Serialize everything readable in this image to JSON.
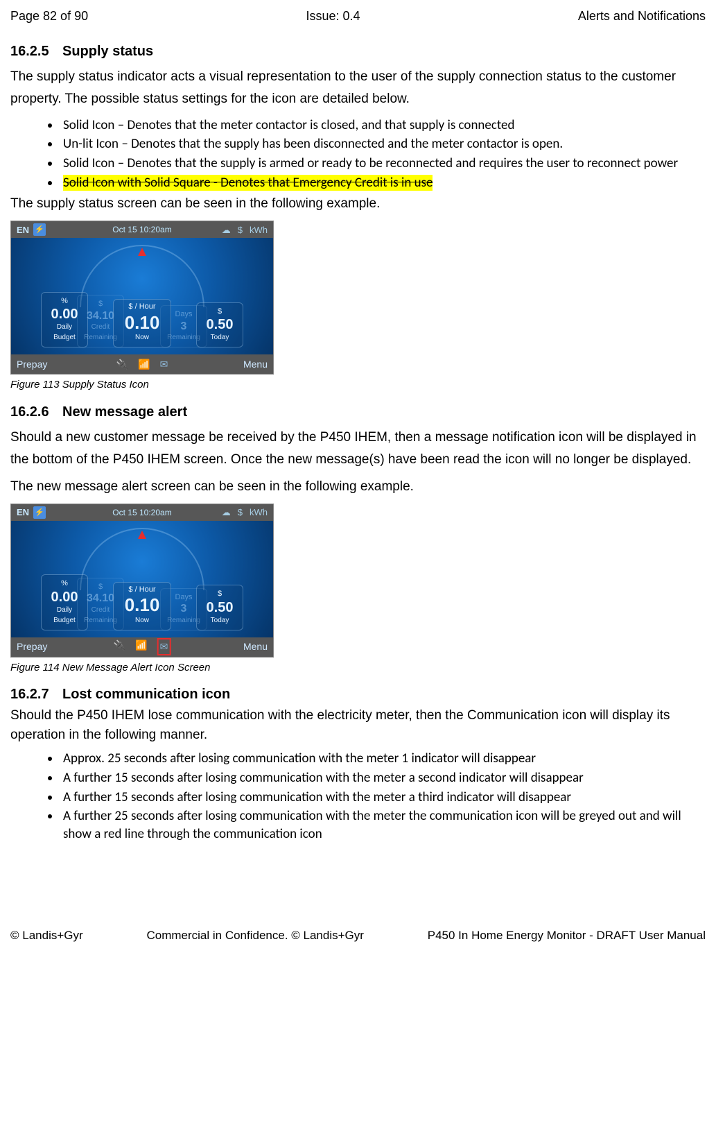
{
  "header": {
    "left": "Page 82 of 90",
    "center": "Issue: 0.4",
    "right": "Alerts and Notifications"
  },
  "s1": {
    "num": "16.2.5",
    "title": "Supply status",
    "p1": "The supply status indicator acts a visual representation to the user of the supply connection status to the customer property. The possible status settings for the icon are detailed below.",
    "b1": "Solid Icon – Denotes that the meter contactor is closed, and that supply is connected",
    "b2": "Un-lit Icon – Denotes that the supply has been disconnected and the meter contactor is open.",
    "b3": "Solid Icon – Denotes that the supply is armed or ready to be reconnected and requires the user to reconnect power",
    "b4": "Solid Icon with Solid Square - Denotes that Emergency Credit is in use",
    "p2": "The supply status screen can be seen in the following example.",
    "cap": "Figure 113 Supply Status Icon"
  },
  "s2": {
    "num": "16.2.6",
    "title": "New message alert",
    "p1": "Should a new customer message be received by the P450 IHEM, then a message notification icon will be displayed in the bottom of the P450 IHEM screen. Once the new message(s) have been read the icon will no longer be displayed.",
    "p2": "The new message alert screen can be seen in the following example.",
    "cap": "Figure 114 New Message Alert Icon Screen"
  },
  "s3": {
    "num": "16.2.7",
    "title": "Lost communication icon",
    "p1": "Should the P450 IHEM lose communication with the electricity meter, then the Communication icon will display its operation in the following manner.",
    "b1": "Approx. 25 seconds after losing communication with the meter 1 indicator will disappear",
    "b2": "A further 15 seconds after losing communication with the meter a second indicator will disappear",
    "b3": "A further 15 seconds after losing communication with the meter a third indicator will disappear",
    "b4": "A further 25 seconds after losing communication with the meter the communication icon will be greyed out and will show a red line through the communication icon"
  },
  "device": {
    "lang": "EN",
    "date": "Oct 15  10:20am",
    "kwh": "kWh",
    "dollar": "$",
    "left": {
      "hdr": "%",
      "val": "0.00",
      "sub": "Daily Budget"
    },
    "ghost_credit": {
      "val": "34.10",
      "sub": "Credit Remaining"
    },
    "center": {
      "hdr": "$ / Hour",
      "val": "0.10",
      "sub": "Now"
    },
    "ghost_days": {
      "hdr": "Days",
      "val": "3",
      "sub": "Remaining"
    },
    "right": {
      "hdr": "$",
      "val": "0.50",
      "sub": "Today"
    },
    "prepay": "Prepay",
    "menu": "Menu"
  },
  "footer": {
    "left": "© Landis+Gyr",
    "center": "Commercial in Confidence. © Landis+Gyr",
    "right": "P450 In Home Energy Monitor - DRAFT User Manual"
  }
}
